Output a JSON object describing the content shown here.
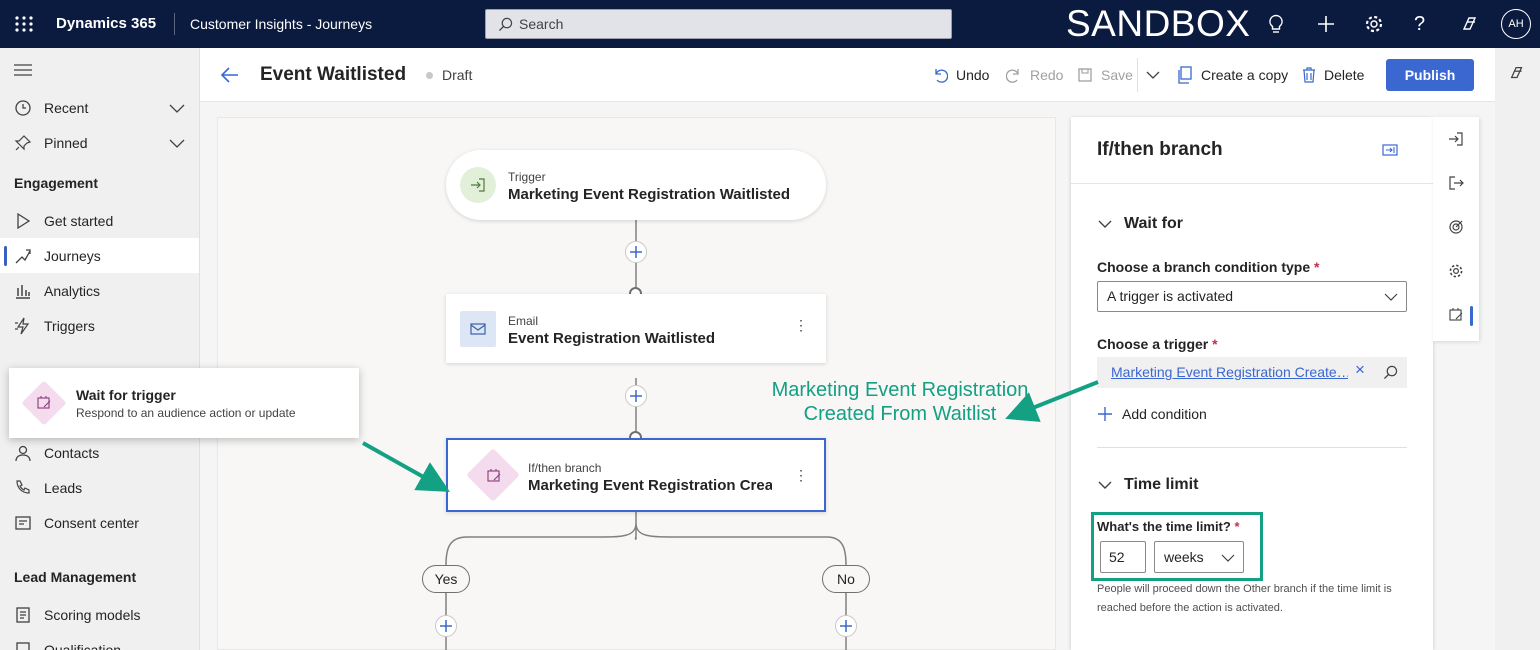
{
  "topbar": {
    "app_name": "Dynamics 365",
    "area_name": "Customer Insights - Journeys",
    "search_placeholder": "Search",
    "environment": "SANDBOX",
    "avatar_initials": "AH",
    "bg_color": "#0b1a3f"
  },
  "nav": {
    "recent": "Recent",
    "pinned": "Pinned",
    "section_engagement": "Engagement",
    "get_started": "Get started",
    "journeys": "Journeys",
    "analytics": "Analytics",
    "triggers": "Triggers",
    "contacts": "Contacts",
    "leads": "Leads",
    "consent_center": "Consent center",
    "section_lead_mgmt": "Lead Management",
    "scoring_models": "Scoring models",
    "qualification": "Qualification"
  },
  "header": {
    "title": "Event Waitlisted",
    "status": "Draft"
  },
  "commands": {
    "undo": "Undo",
    "redo": "Redo",
    "save": "Save",
    "create_copy": "Create a copy",
    "delete": "Delete",
    "publish": "Publish",
    "accent": "#3b67d1"
  },
  "canvas": {
    "trigger": {
      "kind": "Trigger",
      "name": "Marketing Event Registration Waitlisted"
    },
    "email": {
      "kind": "Email",
      "name": "Event Registration Waitlisted"
    },
    "branch": {
      "kind": "If/then branch",
      "name": "Marketing Event Registration Created From Waitlist"
    },
    "yes_label": "Yes",
    "no_label": "No"
  },
  "popup": {
    "title": "Wait for trigger",
    "subtitle": "Respond to an audience action or update"
  },
  "annotation": {
    "line1": "Marketing Event Registration",
    "line2": "Created From Waitlist",
    "color": "#13a083"
  },
  "panel": {
    "title": "If/then branch",
    "wait_for_section": "Wait for",
    "condition_type_label": "Choose a branch condition type",
    "condition_type_value": "A trigger is activated",
    "trigger_label": "Choose a trigger",
    "trigger_value": "Marketing Event Registration Create…",
    "add_condition": "Add condition",
    "time_limit_section": "Time limit",
    "time_limit_label": "What's the time limit?",
    "time_limit_value": "52",
    "time_limit_unit": "weeks",
    "help_text": "People will proceed down the Other branch if the time limit is reached before the action is activated.",
    "required_marker": "*"
  }
}
